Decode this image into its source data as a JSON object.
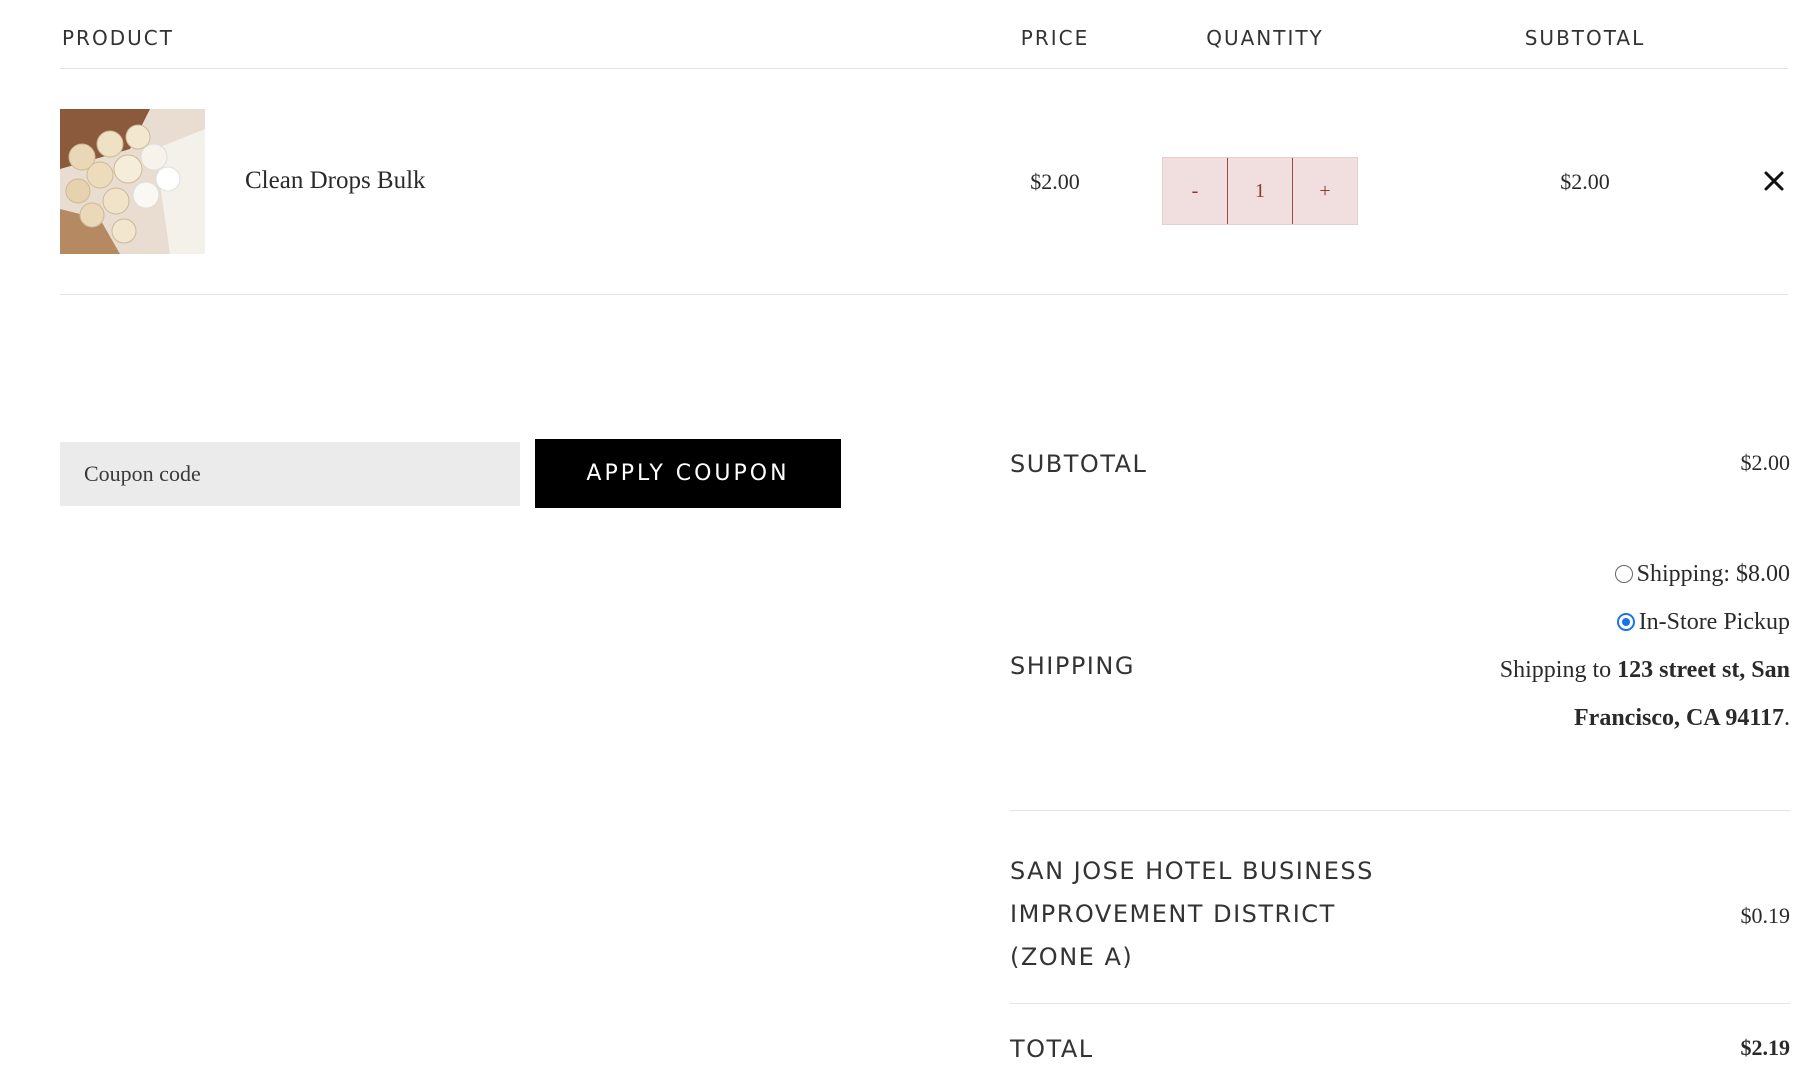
{
  "table": {
    "headers": {
      "product": "PRODUCT",
      "price": "PRICE",
      "quantity": "QUANTITY",
      "subtotal": "SUBTOTAL"
    },
    "items": [
      {
        "name": "Clean Drops Bulk",
        "price": "$2.00",
        "quantity_minus": "-",
        "quantity": "1",
        "quantity_plus": "+",
        "subtotal": "$2.00",
        "remove_icon": "close-icon"
      }
    ]
  },
  "coupon": {
    "placeholder": "Coupon code",
    "value": "",
    "apply_label": "APPLY COUPON"
  },
  "totals": {
    "subtotal_label": "SUBTOTAL",
    "subtotal_value": "$2.00",
    "shipping_label": "SHIPPING",
    "shipping_options": [
      {
        "label": "Shipping: $8.00",
        "selected": false
      },
      {
        "label": "In-Store Pickup",
        "selected": true
      }
    ],
    "shipping_to_prefix": "Shipping to",
    "shipping_to_address": "123 street st, San Francisco, CA 94117",
    "shipping_to_suffix": ".",
    "tax_label": "SAN JOSE HOTEL BUSINESS IMPROVEMENT DISTRICT (ZONE A)",
    "tax_value": "$0.19",
    "total_label": "TOTAL",
    "total_value": "$2.19"
  },
  "colors": {
    "accent_quantity_bg": "#f1dede",
    "accent_quantity_text": "#8a3a2f",
    "button_bg": "#000000",
    "radio_selected": "#1a73e8"
  }
}
